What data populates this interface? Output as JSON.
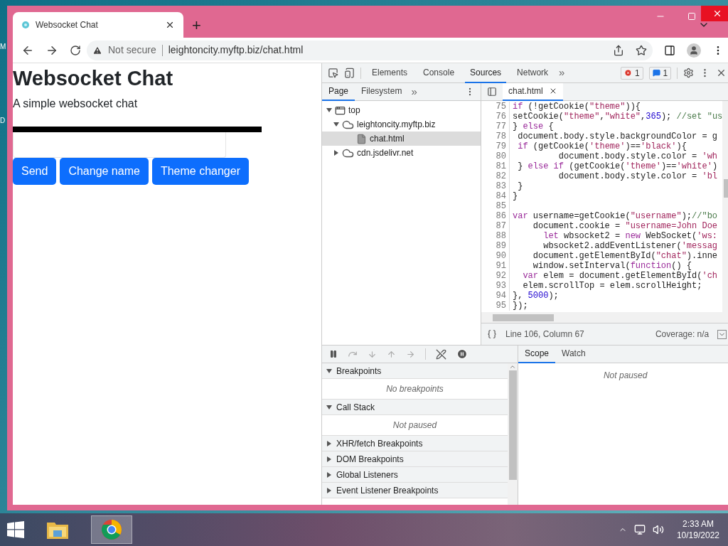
{
  "desktop_labels": [
    "M",
    "D"
  ],
  "browser": {
    "tabs": [
      {
        "title": "Websocket Chat",
        "selected": true
      }
    ],
    "new_tab": "+",
    "security": "Not secure",
    "url": "leightoncity.myftp.biz/chat.html"
  },
  "page": {
    "heading": "Websocket Chat",
    "subtitle": "A simple websocket chat",
    "buttons": [
      "Send",
      "Change name",
      "Theme changer"
    ]
  },
  "devtools": {
    "panel_tabs": [
      {
        "label": "Elements",
        "selected": false
      },
      {
        "label": "Console",
        "selected": false
      },
      {
        "label": "Sources",
        "selected": true
      },
      {
        "label": "Network",
        "selected": false
      }
    ],
    "more": "»",
    "error_count": "1",
    "message_count": "1",
    "navigator": {
      "tabs": [
        {
          "label": "Page",
          "selected": true
        },
        {
          "label": "Filesystem",
          "selected": false
        }
      ],
      "more": "»",
      "tree": [
        {
          "label": "top",
          "kind": "frame",
          "expanded": true,
          "selected": false,
          "children": [
            {
              "label": "leightoncity.myftp.biz",
              "kind": "domain",
              "expanded": true,
              "selected": false,
              "children": [
                {
                  "label": "chat.html",
                  "kind": "file",
                  "selected": true
                }
              ]
            },
            {
              "label": "cdn.jsdelivr.net",
              "kind": "domain",
              "expanded": false,
              "selected": false
            }
          ]
        }
      ]
    },
    "editor": {
      "tabs": [
        {
          "label": "chat.html",
          "selected": true
        }
      ],
      "lines": [
        {
          "number": "75",
          "tokens": [
            {
              "text": "if",
              "kind": "keyword"
            },
            {
              "text": " (!getCookie(",
              "kind": "plain"
            },
            {
              "text": "\"theme\"",
              "kind": "string"
            },
            {
              "text": ")){",
              "kind": "plain"
            }
          ]
        },
        {
          "number": "76",
          "tokens": [
            {
              "text": "setCookie(",
              "kind": "plain"
            },
            {
              "text": "\"theme\"",
              "kind": "string"
            },
            {
              "text": ",",
              "kind": "plain"
            },
            {
              "text": "\"white\"",
              "kind": "string"
            },
            {
              "text": ",",
              "kind": "plain"
            },
            {
              "text": "365",
              "kind": "number"
            },
            {
              "text": "); ",
              "kind": "plain"
            },
            {
              "text": "//set \"us",
              "kind": "comment"
            }
          ]
        },
        {
          "number": "77",
          "tokens": [
            {
              "text": "} ",
              "kind": "plain"
            },
            {
              "text": "else",
              "kind": "keyword"
            },
            {
              "text": " {",
              "kind": "plain"
            }
          ]
        },
        {
          "number": "78",
          "tokens": [
            {
              "text": " document.body.style.backgroundColor = g",
              "kind": "plain"
            }
          ]
        },
        {
          "number": "79",
          "tokens": [
            {
              "text": " if",
              "kind": "keyword"
            },
            {
              "text": " (getCookie(",
              "kind": "plain"
            },
            {
              "text": "'theme'",
              "kind": "string"
            },
            {
              "text": ")==",
              "kind": "plain"
            },
            {
              "text": "'black'",
              "kind": "string"
            },
            {
              "text": "){",
              "kind": "plain"
            }
          ]
        },
        {
          "number": "80",
          "tokens": [
            {
              "text": "         document.body.style.color = ",
              "kind": "plain"
            },
            {
              "text": "'wh",
              "kind": "string"
            }
          ]
        },
        {
          "number": "81",
          "tokens": [
            {
              "text": " } ",
              "kind": "plain"
            },
            {
              "text": "else if",
              "kind": "keyword"
            },
            {
              "text": " (getCookie(",
              "kind": "plain"
            },
            {
              "text": "'theme'",
              "kind": "string"
            },
            {
              "text": ")==",
              "kind": "plain"
            },
            {
              "text": "'white'",
              "kind": "string"
            },
            {
              "text": ")",
              "kind": "plain"
            }
          ]
        },
        {
          "number": "82",
          "tokens": [
            {
              "text": "         document.body.style.color = ",
              "kind": "plain"
            },
            {
              "text": "'bl",
              "kind": "string"
            }
          ]
        },
        {
          "number": "83",
          "tokens": [
            {
              "text": " }",
              "kind": "plain"
            }
          ]
        },
        {
          "number": "84",
          "tokens": [
            {
              "text": "}",
              "kind": "plain"
            }
          ]
        },
        {
          "number": "85"
        },
        {
          "number": "86",
          "tokens": [
            {
              "text": "var",
              "kind": "keyword"
            },
            {
              "text": " username=getCookie(",
              "kind": "plain"
            },
            {
              "text": "\"username\"",
              "kind": "string"
            },
            {
              "text": ");",
              "kind": "plain"
            },
            {
              "text": "//\"bo",
              "kind": "comment"
            }
          ]
        },
        {
          "number": "87",
          "tokens": [
            {
              "text": "    document.cookie = ",
              "kind": "plain"
            },
            {
              "text": "\"username=John Doe",
              "kind": "string"
            }
          ]
        },
        {
          "number": "88",
          "tokens": [
            {
              "text": "      let",
              "kind": "keyword"
            },
            {
              "text": " wbsocket2 = ",
              "kind": "plain"
            },
            {
              "text": "new",
              "kind": "keyword"
            },
            {
              "text": " WebSocket(",
              "kind": "plain"
            },
            {
              "text": "'ws:",
              "kind": "string"
            }
          ]
        },
        {
          "number": "89",
          "tokens": [
            {
              "text": "      wbsocket2.addEventListener(",
              "kind": "plain"
            },
            {
              "text": "'messag",
              "kind": "string"
            }
          ]
        },
        {
          "number": "90",
          "tokens": [
            {
              "text": "    document.getElementById(",
              "kind": "plain"
            },
            {
              "text": "\"chat\"",
              "kind": "string"
            },
            {
              "text": ").inne",
              "kind": "plain"
            }
          ]
        },
        {
          "number": "91",
          "tokens": [
            {
              "text": "    window.setInterval(",
              "kind": "plain"
            },
            {
              "text": "function",
              "kind": "keyword"
            },
            {
              "text": "() {",
              "kind": "plain"
            }
          ]
        },
        {
          "number": "92",
          "tokens": [
            {
              "text": "  var",
              "kind": "keyword"
            },
            {
              "text": " elem = document.getElementById(",
              "kind": "plain"
            },
            {
              "text": "'ch",
              "kind": "string"
            }
          ]
        },
        {
          "number": "93",
          "tokens": [
            {
              "text": "  elem.scrollTop = elem.scrollHeight;",
              "kind": "plain"
            }
          ]
        },
        {
          "number": "94",
          "tokens": [
            {
              "text": "}, ",
              "kind": "plain"
            },
            {
              "text": "5000",
              "kind": "number"
            },
            {
              "text": ");",
              "kind": "plain"
            }
          ]
        },
        {
          "number": "95",
          "tokens": [
            {
              "text": "});",
              "kind": "plain"
            }
          ]
        }
      ],
      "status": {
        "position": "Line 106, Column 67",
        "coverage": "Coverage: n/a"
      }
    },
    "debugger": {
      "sections": [
        {
          "title": "Breakpoints",
          "expanded": true,
          "message": "No breakpoints"
        },
        {
          "title": "Call Stack",
          "expanded": true,
          "message": "Not paused"
        },
        {
          "title": "XHR/fetch Breakpoints",
          "expanded": false
        },
        {
          "title": "DOM Breakpoints",
          "expanded": false
        },
        {
          "title": "Global Listeners",
          "expanded": false
        },
        {
          "title": "Event Listener Breakpoints",
          "expanded": false
        }
      ],
      "side_tabs": [
        {
          "label": "Scope",
          "selected": true
        },
        {
          "label": "Watch",
          "selected": false
        }
      ],
      "side_message": "Not paused"
    }
  },
  "taskbar": {
    "apps": [
      {
        "kind": "explorer",
        "selected": false
      },
      {
        "kind": "chrome",
        "selected": true
      }
    ],
    "time": "2:33 AM",
    "date": "10/19/2022"
  }
}
